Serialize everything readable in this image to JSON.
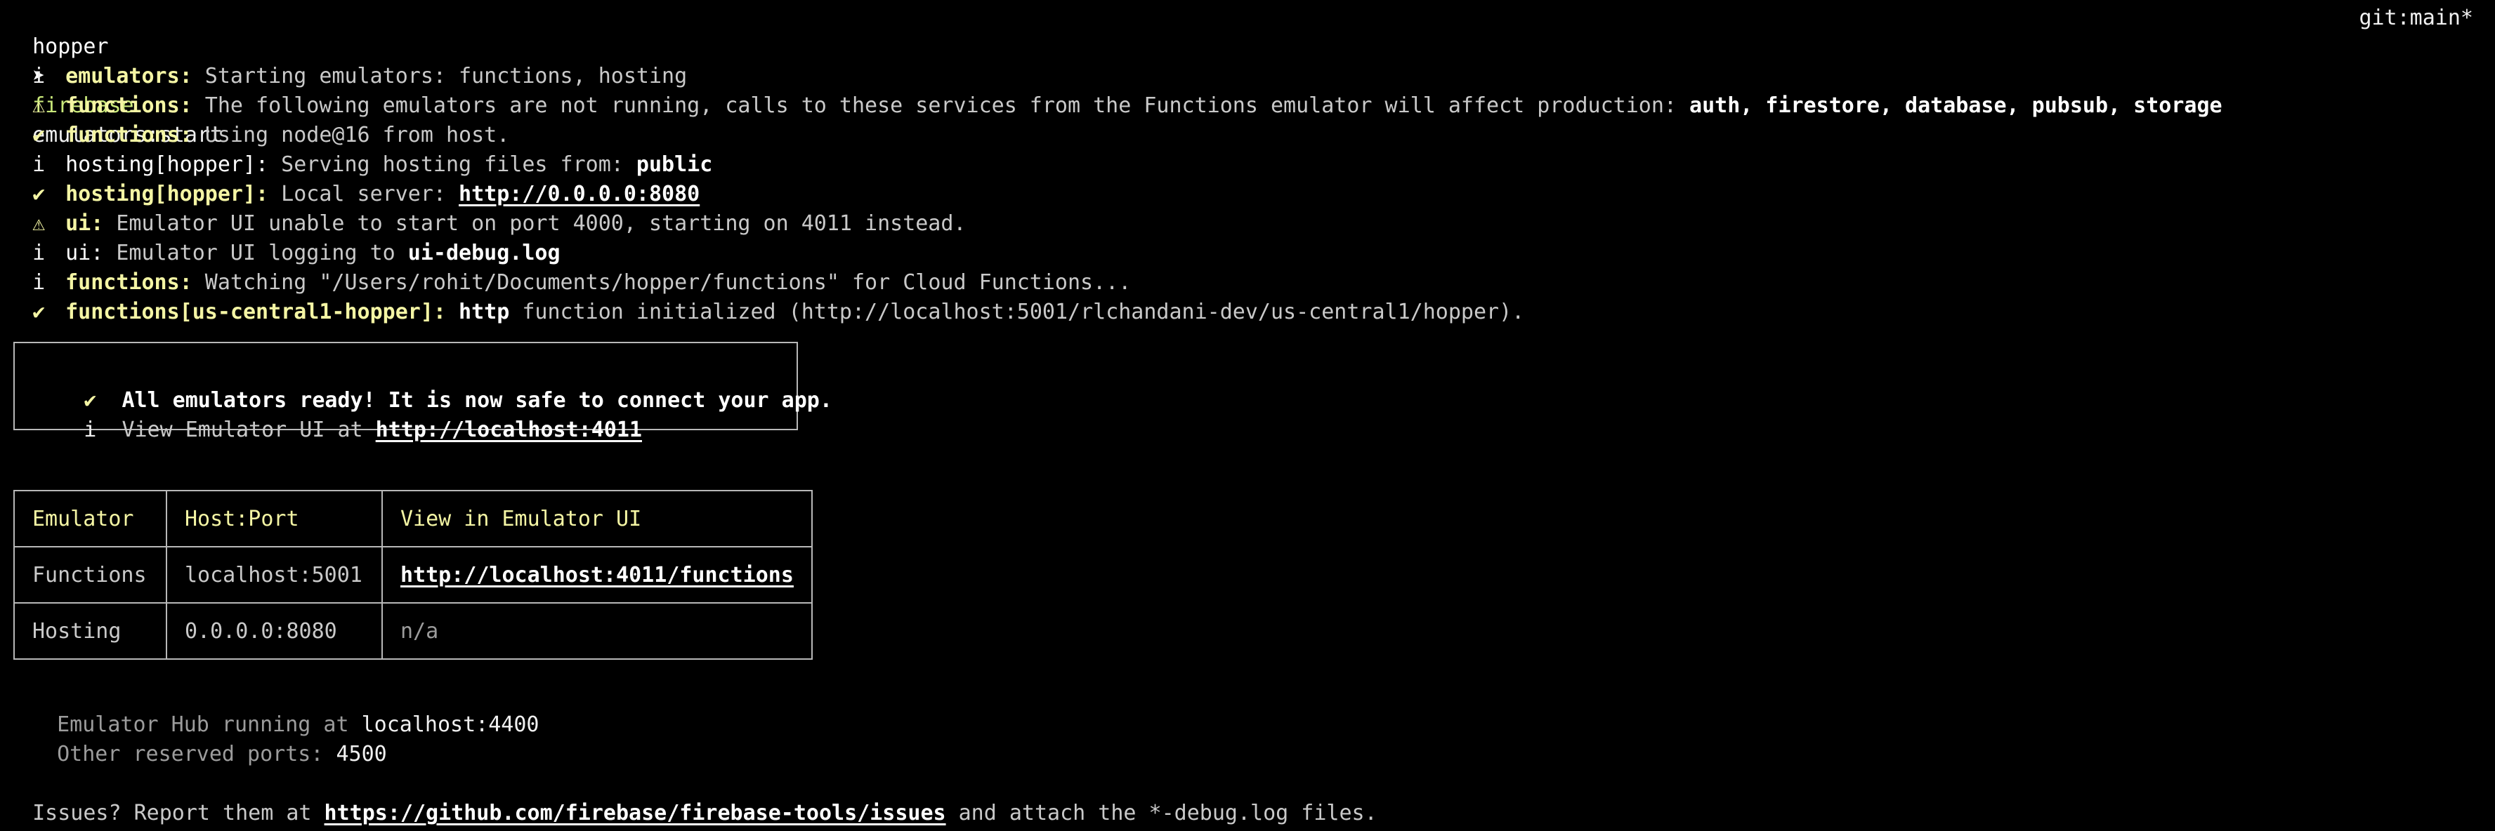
{
  "prompt": {
    "cwd": "hopper",
    "arrow": "➤",
    "command": "firebase",
    "args": "emulators:start",
    "git_branch": "git:main*"
  },
  "log": [
    {
      "symbol": "i",
      "source": "emulators:",
      "text": " Starting emulators: functions, hosting"
    },
    {
      "symbol": "⚠",
      "source": "functions:",
      "text": " The following emulators are not running, calls to these services from the Functions emulator will affect production: ",
      "bold": "auth, firestore, database, pubsub, storage"
    },
    {
      "symbol": "✔",
      "source": "functions:",
      "text": " Using node@16 from host."
    },
    {
      "symbol": "i",
      "source": "hosting[hopper]:",
      "text": " Serving hosting files from: ",
      "bold": "public"
    },
    {
      "symbol": "✔",
      "source": "hosting[hopper]:",
      "text": " Local server: ",
      "link": "http://0.0.0.0:8080"
    },
    {
      "symbol": "⚠",
      "source": "ui:",
      "text": " Emulator UI unable to start on port 4000, starting on 4011 instead."
    },
    {
      "symbol": "i",
      "source": "ui:",
      "text": " Emulator UI logging to ",
      "bold": "ui-debug.log"
    },
    {
      "symbol": "i",
      "source": "functions:",
      "text": " Watching \"/Users/rohit/Documents/hopper/functions\" for Cloud Functions..."
    },
    {
      "symbol": "✔",
      "source": "functions[us-central1-hopper]:",
      "bold_prefix": "http",
      "text": " function initialized (http://localhost:5001/rlchandani-dev/us-central1/hopper)."
    }
  ],
  "ready_box": {
    "check": "✔",
    "message": "All emulators ready! It is now safe to connect your app.",
    "info": "i",
    "ui_text": "View Emulator UI at ",
    "ui_link": "http://localhost:4011"
  },
  "table": {
    "headers": [
      "Emulator",
      "Host:Port",
      "View in Emulator UI"
    ],
    "rows": [
      {
        "emulator": "Functions",
        "host": "localhost:5001",
        "view": "http://localhost:4011/functions"
      },
      {
        "emulator": "Hosting",
        "host": "0.0.0.0:8080",
        "view": "n/a"
      }
    ]
  },
  "footer": {
    "hub_label": "Emulator Hub running at ",
    "hub_value": "localhost:4400",
    "ports_label": "Other reserved ports: ",
    "ports_value": "4500",
    "issues_prefix": "Issues? Report them at ",
    "issues_link": "https://github.com/firebase/firebase-tools/issues",
    "issues_suffix": " and attach the *-debug.log files."
  },
  "colors": {
    "background": "#000000",
    "text": "#c9c9c9",
    "source_yellow": "#f4f5a4",
    "bold_white": "#ffffff",
    "command_green": "#c9e87a",
    "dim": "#9c9c9c"
  }
}
